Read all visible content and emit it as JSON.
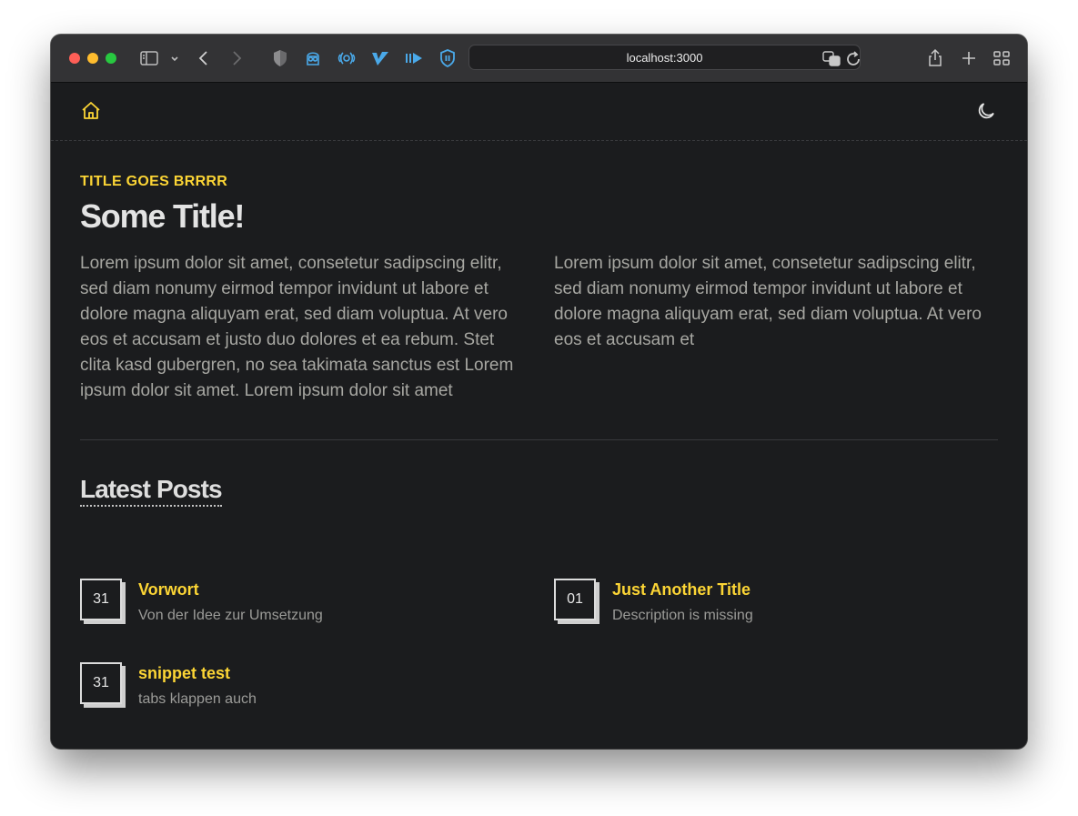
{
  "browser": {
    "url": "localhost:3000",
    "toolbar_icons": [
      "sidebar-icon",
      "chevron-down-icon",
      "back-icon",
      "forward-icon",
      "shield-icon",
      "extension-icon",
      "extension-icon",
      "extension-icon",
      "extension-icon",
      "extension-icon",
      "translate-icon",
      "reload-icon",
      "share-icon",
      "new-tab-icon",
      "tab-overview-icon"
    ]
  },
  "header": {
    "home_icon": "home-icon",
    "theme_icon": "moon-icon"
  },
  "hero": {
    "kicker": "TITLE GOES BRRRR",
    "title": "Some Title!",
    "paragraph_left": "Lorem ipsum dolor sit amet, consetetur sadipscing elitr, sed diam nonumy eirmod tempor invidunt ut labore et dolore magna aliquyam erat, sed diam voluptua. At vero eos et accusam et justo duo dolores et ea rebum. Stet clita kasd gubergren, no sea takimata sanctus est Lorem ipsum dolor sit amet. Lorem ipsum dolor sit amet",
    "paragraph_right": "Lorem ipsum dolor sit amet, consetetur sadipscing elitr, sed diam nonumy eirmod tempor invidunt ut labore et dolore magna aliquyam erat, sed diam voluptua. At vero eos et accusam et"
  },
  "posts": {
    "heading": "Latest Posts",
    "items": [
      {
        "day": "31",
        "title": "Vorwort",
        "description": "Von der Idee zur Umsetzung"
      },
      {
        "day": "01",
        "title": "Just Another Title",
        "description": "Description is missing"
      },
      {
        "day": "31",
        "title": "snippet test",
        "description": "tabs klappen auch"
      }
    ]
  },
  "colors": {
    "accent": "#fcd535",
    "background": "#1b1c1e",
    "text": "#a7a7a2"
  }
}
